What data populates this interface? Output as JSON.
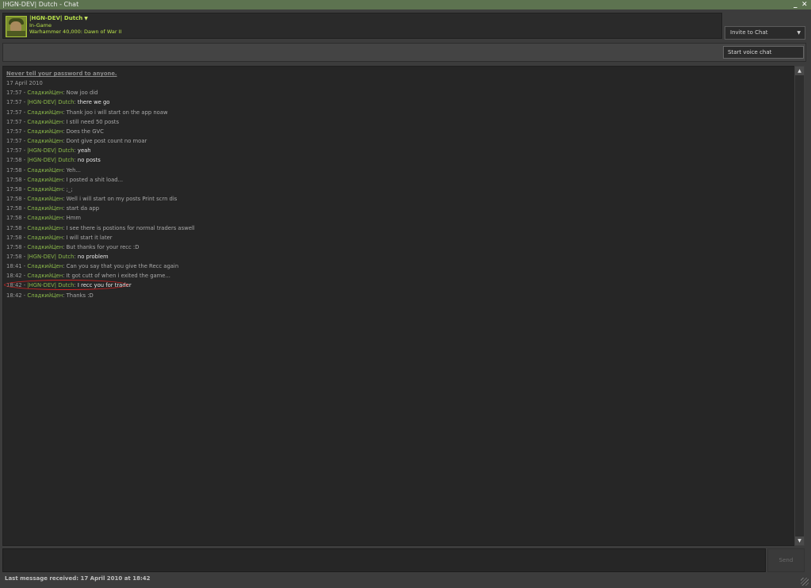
{
  "window": {
    "title": "|HGN-DEV| Dutch - Chat",
    "minimize": "_",
    "close": "✕"
  },
  "header": {
    "user_name": "|HGN-DEV| Dutch",
    "status": "In-Game",
    "game": "Warhammer 40,000: Dawn of War II"
  },
  "invite": {
    "label": "Invite to Chat"
  },
  "voice": {
    "label": "Start voice chat"
  },
  "log": {
    "warning": "Never tell your password to anyone.",
    "date": "17 April 2010",
    "lines": [
      {
        "time": "17:57",
        "sep": " - ",
        "name": "СладкийЦен",
        "msg": "Now joo did",
        "self": false
      },
      {
        "time": "17:57",
        "sep": " - ",
        "name": "|HGN-DEV| Dutch",
        "msg": "there we go",
        "self": true
      },
      {
        "time": "17:57",
        "sep": " - ",
        "name": "СладкийЦен",
        "msg": "Thank joo i will start on the app noaw",
        "self": false
      },
      {
        "time": "17:57",
        "sep": " - ",
        "name": "СладкийЦен",
        "msg": "I still need 50 posts",
        "self": false
      },
      {
        "time": "17:57",
        "sep": " - ",
        "name": "СладкийЦен",
        "msg": "Does the GVC",
        "self": false
      },
      {
        "time": "17:57",
        "sep": " - ",
        "name": "СладкийЦен",
        "msg": "Dont give post count no moar",
        "self": false
      },
      {
        "time": "17:57",
        "sep": " - ",
        "name": "|HGN-DEV| Dutch",
        "msg": "yeah",
        "self": true
      },
      {
        "time": "17:58",
        "sep": " - ",
        "name": "|HGN-DEV| Dutch",
        "msg": "no posts",
        "self": true
      },
      {
        "time": "17:58",
        "sep": " - ",
        "name": "СладкийЦен",
        "msg": "Yeh...",
        "self": false
      },
      {
        "time": "17:58",
        "sep": " - ",
        "name": "СладкийЦен",
        "msg": "I posted a shit load...",
        "self": false
      },
      {
        "time": "17:58",
        "sep": " - ",
        "name": "СладкийЦен",
        "msg": ";_;",
        "self": false
      },
      {
        "time": "17:58",
        "sep": " - ",
        "name": "СладкийЦен",
        "msg": "Well i will start on my posts Print scrn dis",
        "self": false
      },
      {
        "time": "17:58",
        "sep": " - ",
        "name": "СладкийЦен",
        "msg": "start da app",
        "self": false
      },
      {
        "time": "17:58",
        "sep": " - ",
        "name": "СладкийЦен",
        "msg": "Hmm",
        "self": false
      },
      {
        "time": "17:58",
        "sep": " - ",
        "name": "СладкийЦен",
        "msg": "I see there is postions for normal traders aswell",
        "self": false
      },
      {
        "time": "17:58",
        "sep": " - ",
        "name": "СладкийЦен",
        "msg": "I will start it later",
        "self": false
      },
      {
        "time": "17:58",
        "sep": " - ",
        "name": "СладкийЦен",
        "msg": "But thanks for your recc :D",
        "self": false
      },
      {
        "time": "17:58",
        "sep": " - ",
        "name": "|HGN-DEV| Dutch",
        "msg": "no problem",
        "self": true
      },
      {
        "time": "18:41",
        "sep": " - ",
        "name": "СладкийЦен",
        "msg": "Can you say that you give the Recc again",
        "self": false
      },
      {
        "time": "18:42",
        "sep": " - ",
        "name": "СладкийЦен",
        "msg": "It got cutt of when i exited the game...",
        "self": false
      },
      {
        "time": "18:42",
        "sep": " - ",
        "name": "|HGN-DEV| Dutch",
        "msg": "I recc you for trader",
        "self": true,
        "circled": true
      },
      {
        "time": "18:42",
        "sep": " - ",
        "name": "СладкийЦен",
        "msg": "Thanks :D",
        "self": false
      }
    ]
  },
  "compose": {
    "value": "",
    "send_label": "Send"
  },
  "footer": {
    "last_message": "Last message received: 17 April 2010 at 18:42"
  }
}
